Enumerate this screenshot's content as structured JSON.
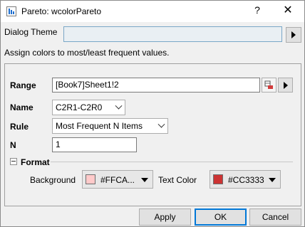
{
  "window": {
    "title": "Pareto: wcolorPareto",
    "help_label": "?",
    "close_label": "✕"
  },
  "theme": {
    "label": "Dialog Theme",
    "value": ""
  },
  "description": "Assign colors to most/least frequent values.",
  "form": {
    "range": {
      "label": "Range",
      "value": "[Book7]Sheet1!2"
    },
    "name": {
      "label": "Name",
      "value": "C2R1-C2R0"
    },
    "rule": {
      "label": "Rule",
      "value": "Most Frequent N Items"
    },
    "n": {
      "label": "N",
      "value": "1"
    },
    "format": {
      "label": "Format",
      "background": {
        "label": "Background",
        "value": "#FFCA...",
        "color": "#FFCACA"
      },
      "text_color": {
        "label": "Text Color",
        "value": "#CC3333",
        "color": "#CC3333"
      }
    }
  },
  "buttons": {
    "apply": "Apply",
    "ok": "OK",
    "cancel": "Cancel"
  }
}
